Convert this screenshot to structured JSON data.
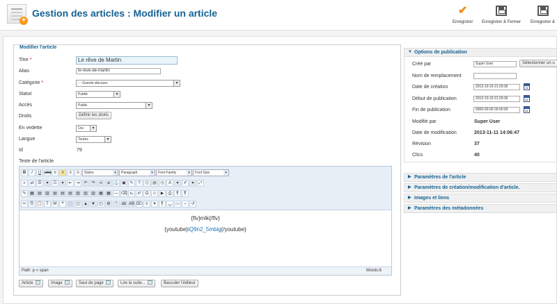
{
  "header": {
    "title": "Gestion des articles : Modifier un article",
    "buttons": [
      "Enregistrer",
      "Enregistrer & Fermer",
      "Enregistrer &"
    ]
  },
  "form": {
    "legend": "Modifier l'article",
    "title_label": "Titre",
    "title_value": "Le rêve de Martin",
    "alias_label": "Alias",
    "alias_value": "le-reve-de-martin",
    "category_label": "Catégorie",
    "category_value": "- - Grands discours",
    "status_label": "Statut",
    "status_value": "Publié",
    "access_label": "Accès",
    "access_value": "Public",
    "rights_label": "Droits",
    "rights_button": "Définir les droits",
    "featured_label": "En vedette",
    "featured_value": "Oui",
    "language_label": "Langue",
    "language_value": "Toutes",
    "id_label": "Id",
    "id_value": "79",
    "text_label": "Texte de l'article",
    "required_mark": "*"
  },
  "editor": {
    "styles": "Styles",
    "paragraph": "Paragraph",
    "font_family": "Font Family",
    "font_size": "Font Size",
    "line1": "{flv}mlk{/flv}",
    "line2_prefix": "{youtube}",
    "line2_link": "iQ9n2_5mbig",
    "line2_suffix": "{/youtube}",
    "path": "Path: p » span",
    "words": "Words:6"
  },
  "editor_buttons": [
    "Article",
    "Image",
    "Saut de page",
    "Lire la suite...",
    "Basculer l'éditeur"
  ],
  "publication": {
    "heading": "Options de publication",
    "created_by_label": "Créé par",
    "created_by_value": "Super User",
    "select_user_button": "Sélectionner un u",
    "alias_name_label": "Nom de remplacement",
    "created_label": "Date de création",
    "created_value": "2013-10-19 21:29:39",
    "publish_up_label": "Début de publication",
    "publish_up_value": "2013-10-19 21:29:39",
    "publish_down_label": "Fin de publication",
    "publish_down_value": "0000-00-00 00:00:00",
    "modified_by_label": "Modifié par",
    "modified_by_value": "Super User",
    "modified_label": "Date de modification",
    "modified_value": "2013-11-11 14:06:47",
    "revision_label": "Révision",
    "revision_value": "37",
    "hits_label": "Clics",
    "hits_value": "40"
  },
  "collapsed_panels": [
    "Paramètres de l'article",
    "Paramètres de création/modification d'article.",
    "Images et liens",
    "Paramètres des métadonnées"
  ],
  "colors": {
    "title_blue": "#146295",
    "accent_orange": "#f08c1a"
  }
}
